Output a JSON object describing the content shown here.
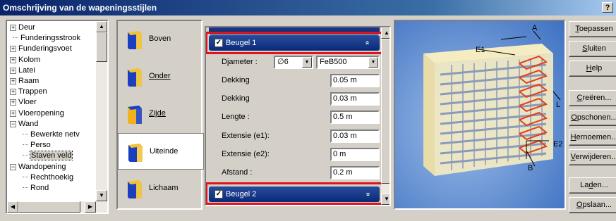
{
  "window": {
    "title": "Omschrijving van de wapeningsstijlen",
    "help_label": "?"
  },
  "tree": {
    "items": [
      {
        "label": "Deur",
        "expander": "+",
        "level": 0
      },
      {
        "label": "Funderingsstrook",
        "expander": "",
        "level": 0
      },
      {
        "label": "Funderingsvoet",
        "expander": "+",
        "level": 0
      },
      {
        "label": "Kolom",
        "expander": "+",
        "level": 0
      },
      {
        "label": "Latei",
        "expander": "+",
        "level": 0
      },
      {
        "label": "Raam",
        "expander": "+",
        "level": 0
      },
      {
        "label": "Trappen",
        "expander": "+",
        "level": 0
      },
      {
        "label": "Vloer",
        "expander": "+",
        "level": 0
      },
      {
        "label": "Vloeropening",
        "expander": "+",
        "level": 0
      },
      {
        "label": "Wand",
        "expander": "−",
        "level": 0
      },
      {
        "label": "Bewerkte netv",
        "expander": "",
        "level": 1
      },
      {
        "label": "Perso",
        "expander": "",
        "level": 1
      },
      {
        "label": "Staven veld",
        "expander": "",
        "level": 1,
        "selected": true
      },
      {
        "label": "Wandopening",
        "expander": "−",
        "level": 0
      },
      {
        "label": "Rechthoekig",
        "expander": "",
        "level": 1
      },
      {
        "label": "Rond",
        "expander": "",
        "level": 1
      }
    ]
  },
  "categories": [
    {
      "label": "Boven",
      "accent": "#1a3fbf",
      "face": "#f2c233"
    },
    {
      "label": "Onder",
      "accent": "#1a3fbf",
      "face": "#f2c233"
    },
    {
      "label": "Zijde",
      "accent": "#f2b21e",
      "face": "#1a3fbf"
    },
    {
      "label": "Uiteinde",
      "accent": "#1a3fbf",
      "face": "#f2c233",
      "active": true
    },
    {
      "label": "Lichaam",
      "accent": "#1a3fbf",
      "face": "#f2c233"
    }
  ],
  "panel": {
    "section1": {
      "label": "Beugel 1",
      "checked": true,
      "chevron": "»"
    },
    "diameter": {
      "label": "Djameter :",
      "size_value": "∅6",
      "grade_value": "FeB500"
    },
    "rows": [
      {
        "label": "Dekking",
        "value": "0.05 m"
      },
      {
        "label": "Dekking",
        "value": "0.03 m"
      },
      {
        "label": "Lengte :",
        "value": "0.5 m"
      },
      {
        "label": "Extensie (e1):",
        "value": "0.03 m"
      },
      {
        "label": "Extensie (e2):",
        "value": "0 m"
      },
      {
        "label": "Afstand :",
        "value": "0.2 m"
      }
    ],
    "section2": {
      "label": "Beugel 2",
      "checked": true,
      "chevron": "»"
    }
  },
  "preview": {
    "labels": {
      "a": "A",
      "e1": "E1",
      "l": "L",
      "e2": "E2",
      "b": "B"
    },
    "colors": {
      "wall": "#f6ecc2",
      "bar": "#8a9ab8",
      "highlight": "#e0401c",
      "background": "#5f8ecf"
    }
  },
  "buttons": [
    {
      "label": "Toepassen",
      "ul_index": 0
    },
    {
      "label": "Sluiten",
      "ul_index": 0
    },
    {
      "label": "Help",
      "ul_index": 0
    },
    {
      "label": "Creëren...",
      "ul_index": 0
    },
    {
      "label": "Opschonen...",
      "ul_index": 0
    },
    {
      "label": "Hernoemen...",
      "ul_index": 0
    },
    {
      "label": "Verwijderen...",
      "ul_index": 0
    },
    {
      "label": "Laden...",
      "ul_index": 2
    },
    {
      "label": "Opslaan...",
      "ul_index": 0
    }
  ]
}
